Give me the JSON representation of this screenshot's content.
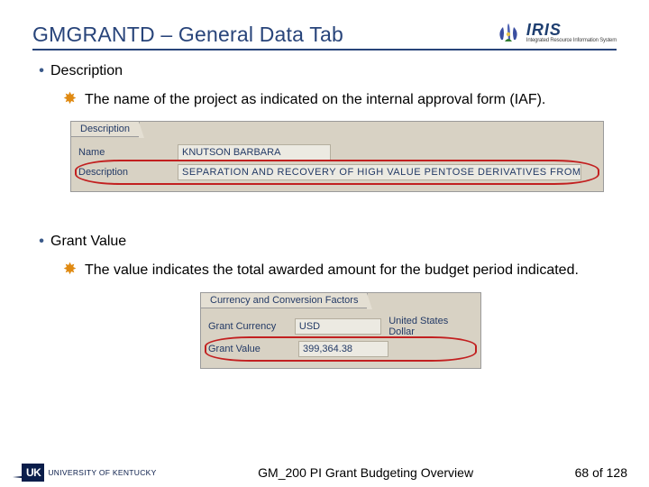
{
  "header": {
    "title": "GMGRANTD – General Data Tab",
    "logo_main": "IRIS",
    "logo_sub": "Integrated Resource Information System"
  },
  "section1": {
    "bullet": "Description",
    "star_text": "The name of the project as indicated on the internal approval form (IAF).",
    "shot": {
      "tab": "Description",
      "name_label": "Name",
      "name_value": "KNUTSON BARBARA",
      "desc_label": "Description",
      "desc_value": "SEPARATION AND RECOVERY OF HIGH VALUE PENTOSE DERIVATIVES FROM CELLULOSIC BIOM"
    }
  },
  "section2": {
    "bullet": "Grant Value",
    "star_text": "The value indicates the total awarded amount for the budget period indicated.",
    "shot": {
      "tab": "Currency and Conversion Factors",
      "currency_label": "Grant Currency",
      "currency_value": "USD",
      "currency_extra": "United States Dollar",
      "value_label": "Grant Value",
      "value_value": "399,364.38"
    }
  },
  "footer": {
    "uk_abbr": "UK",
    "uk_name": "UNIVERSITY OF KENTUCKY",
    "doc_title": "GM_200 PI Grant Budgeting Overview",
    "pager": "68 of 128"
  }
}
